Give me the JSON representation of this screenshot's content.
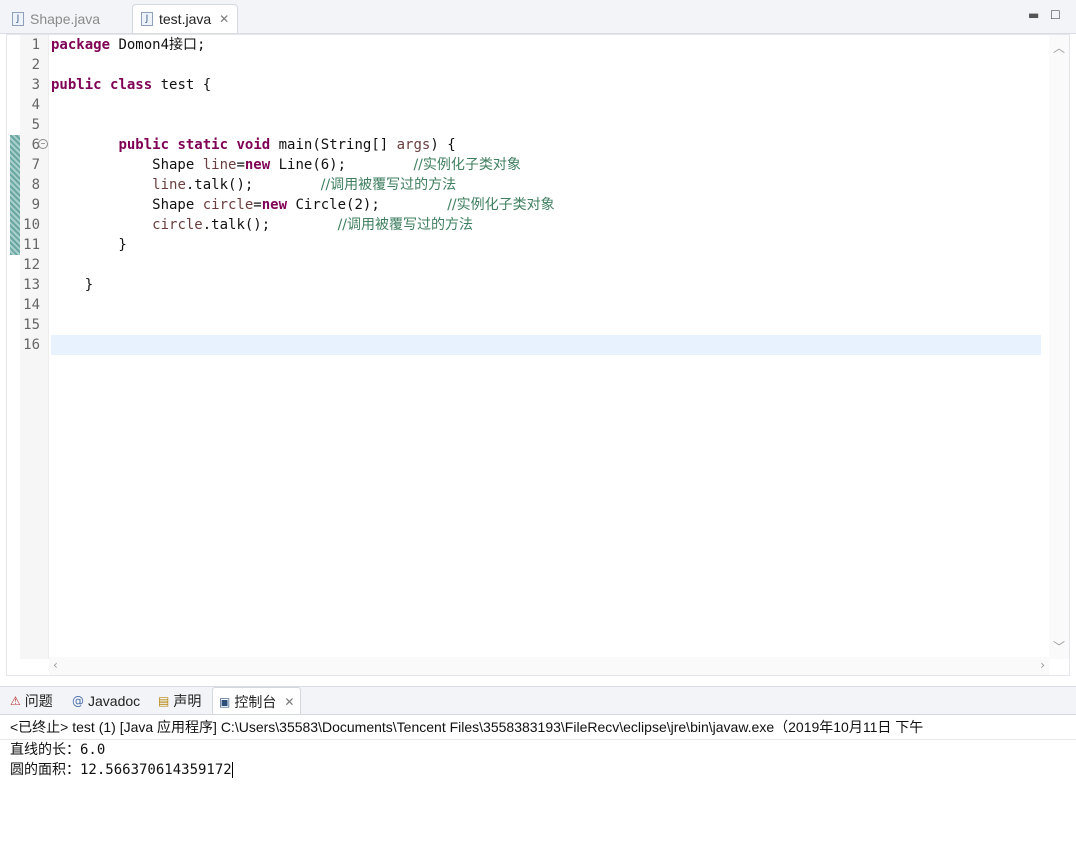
{
  "editor": {
    "tabs": [
      {
        "label": "Shape.java",
        "active": false
      },
      {
        "label": "test.java",
        "active": true
      }
    ],
    "line_numbers": [
      "1",
      "2",
      "3",
      "4",
      "5",
      "6",
      "7",
      "8",
      "9",
      "10",
      "11",
      "12",
      "13",
      "14",
      "15",
      "16"
    ],
    "code": {
      "l1_kw": "package",
      "l1_rest": " Domon4接口;",
      "l3_kw1": "public",
      "l3_kw2": "class",
      "l3_rest": " test {",
      "l6_indent": "        ",
      "l6_kw1": "public",
      "l6_kw2": "static",
      "l6_kw3": "void",
      "l6_rest": " main(String[] ",
      "l6_var": "args",
      "l6_end": ") {",
      "l7_pre": "            Shape ",
      "l7_var": "line",
      "l7_eq": "=",
      "l7_kw": "new",
      "l7_rest": " Line(6);        ",
      "l7_cm": "//实例化子类对象",
      "l8_pre": "            ",
      "l8_var": "line",
      "l8_rest": ".talk();        ",
      "l8_cm": "//调用被覆写过的方法",
      "l9_pre": "            Shape ",
      "l9_var": "circle",
      "l9_eq": "=",
      "l9_kw": "new",
      "l9_rest": " Circle(2);        ",
      "l9_cm": "//实例化子类对象",
      "l10_pre": "            ",
      "l10_var": "circle",
      "l10_rest": ".talk();        ",
      "l10_cm": "//调用被覆写过的方法",
      "l11": "        }",
      "l13": "    }"
    },
    "current_line": 16
  },
  "panel": {
    "tabs": [
      {
        "label": "问题",
        "active": false
      },
      {
        "label": "Javadoc",
        "active": false
      },
      {
        "label": "声明",
        "active": false
      },
      {
        "label": "控制台",
        "active": true
      }
    ],
    "console_header": "<已终止> test (1)  [Java 应用程序] C:\\Users\\35583\\Documents\\Tencent Files\\3558383193\\FileRecv\\eclipse\\jre\\bin\\javaw.exe（2019年10月11日 下午",
    "output": [
      "直线的长：6.0",
      "圆的面积：12.566370614359172"
    ]
  },
  "icons": {
    "java_file": "java-file-icon",
    "close": "close-icon",
    "minimize": "minimize-icon",
    "maximize": "maximize-icon",
    "problems": "problems-icon",
    "javadoc": "at-sign-icon",
    "declaration": "declaration-icon",
    "console": "console-icon"
  },
  "colors": {
    "keyword": "#7f0055",
    "comment": "#3f7f5f",
    "variable": "#6a3e3e",
    "current_line": "#e8f2fe"
  }
}
